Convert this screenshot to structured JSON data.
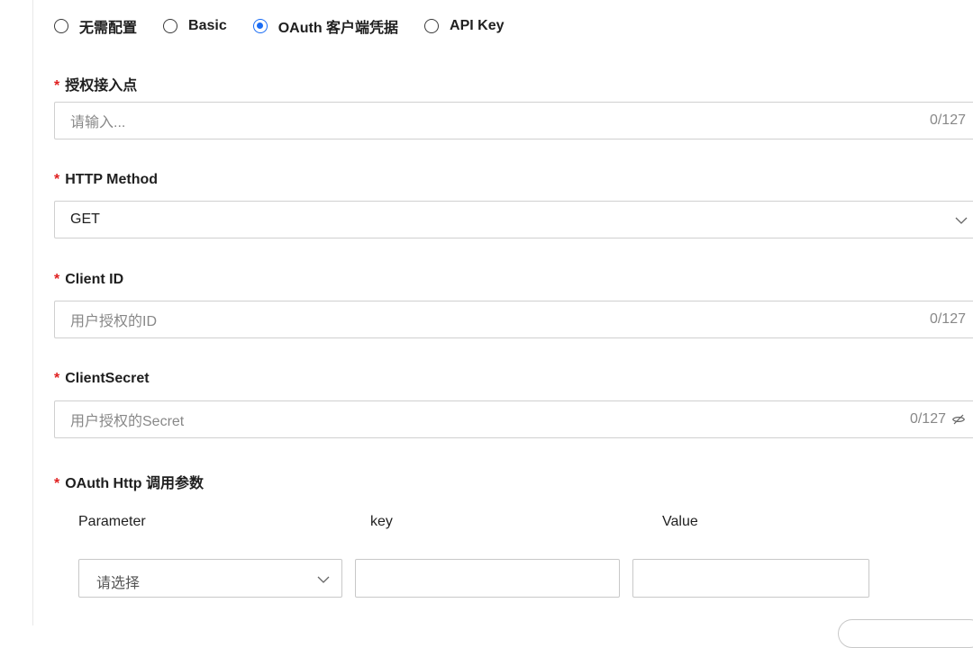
{
  "auth_type": {
    "options": [
      {
        "label": "无需配置",
        "selected": false
      },
      {
        "label": "Basic",
        "selected": false
      },
      {
        "label": "OAuth 客户端凭据",
        "selected": true
      },
      {
        "label": "API Key",
        "selected": false
      }
    ]
  },
  "required_mark": "*",
  "fields": {
    "auth_endpoint": {
      "label": "授权接入点",
      "placeholder": "请输入...",
      "counter": "0/127"
    },
    "http_method": {
      "label": "HTTP Method",
      "value": "GET"
    },
    "client_id": {
      "label": "Client ID",
      "placeholder": "用户授权的ID",
      "counter": "0/127"
    },
    "client_secret": {
      "label": "ClientSecret",
      "placeholder": "用户授权的Secret",
      "counter": "0/127"
    }
  },
  "params": {
    "label": "OAuth Http 调用参数",
    "headers": [
      "Parameter",
      "key",
      "Value"
    ],
    "row": {
      "parameter_placeholder": "请选择",
      "key_value": "",
      "value_value": ""
    }
  },
  "colors": {
    "accent": "#1a6cf4",
    "required": "#e02020",
    "border": "#d0d0d0"
  },
  "icons": [
    "chevron-down-icon",
    "eye-off-icon"
  ]
}
